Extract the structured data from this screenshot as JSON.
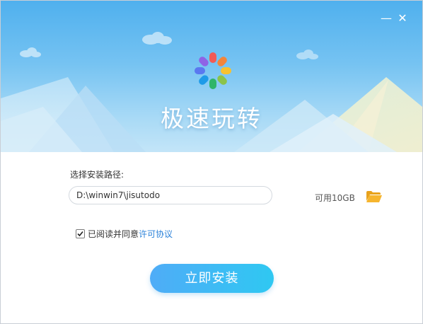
{
  "window": {
    "minimize_symbol": "—",
    "close_symbol": "✕"
  },
  "header": {
    "app_title": "极速玩转",
    "logo_icon": "color-wheel-logo-icon",
    "petal_colors": [
      "#f25a55",
      "#f2853b",
      "#f7c22f",
      "#8bc34a",
      "#2fb56a",
      "#1e9be8",
      "#5a78f0",
      "#8f63e6"
    ]
  },
  "install_path": {
    "label": "选择安装路径:",
    "value": "D:\\winwin7\\jisutodo",
    "free_space": "可用10GB",
    "browse_icon": "folder-icon"
  },
  "agreement": {
    "checked": true,
    "text": "已阅读并同意",
    "link_text": "许可协议"
  },
  "install_button": {
    "label": "立即安装"
  },
  "colors": {
    "accent": "#2b82d9",
    "button_start": "#4facf7",
    "button_end": "#2fc8f2",
    "header_top": "#4fb0ee"
  }
}
